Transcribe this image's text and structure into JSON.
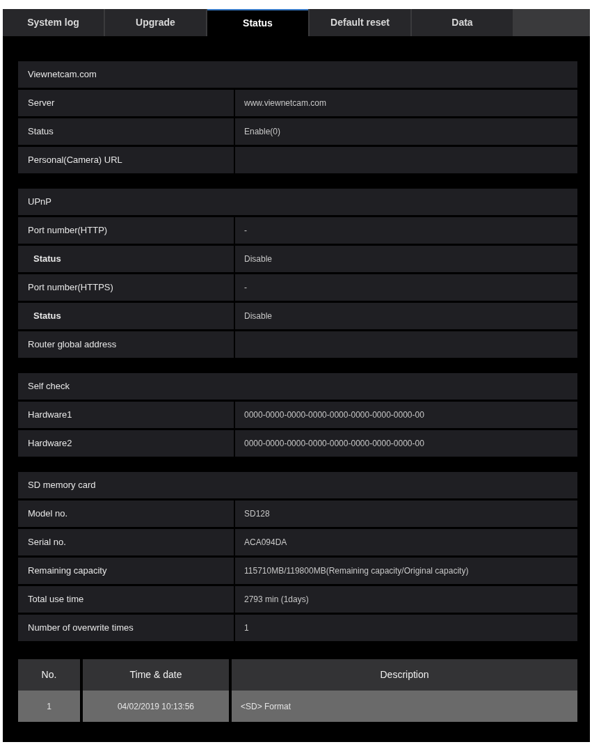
{
  "tabs": [
    {
      "label": "System log",
      "selected": false
    },
    {
      "label": "Upgrade",
      "selected": false
    },
    {
      "label": "Status",
      "selected": true
    },
    {
      "label": "Default reset",
      "selected": false
    },
    {
      "label": "Data",
      "selected": false
    }
  ],
  "sections": [
    {
      "title": "Viewnetcam.com",
      "rows": [
        {
          "label": "Server",
          "value": "www.viewnetcam.com",
          "indented": false
        },
        {
          "label": "Status",
          "value": "Enable(0)",
          "indented": false
        },
        {
          "label": "Personal(Camera) URL",
          "indented": false
        }
      ]
    },
    {
      "title": "UPnP",
      "rows": [
        {
          "label": "Port number(HTTP)",
          "value": "-",
          "indented": false
        },
        {
          "label": "Status",
          "value": "Disable",
          "indented": true
        },
        {
          "label": "Port number(HTTPS)",
          "value": "-",
          "indented": false
        },
        {
          "label": "Status",
          "value": "Disable",
          "indented": true
        },
        {
          "label": "Router global address",
          "indented": false
        }
      ]
    },
    {
      "title": "Self check",
      "rows": [
        {
          "label": "Hardware1",
          "value": "0000-0000-0000-0000-0000-0000-0000-0000-00",
          "indented": false
        },
        {
          "label": "Hardware2",
          "value": "0000-0000-0000-0000-0000-0000-0000-0000-00",
          "indented": false
        }
      ]
    },
    {
      "title": "SD memory card",
      "rows": [
        {
          "label": "Model no.",
          "value": "SD128",
          "indented": false
        },
        {
          "label": "Serial no.",
          "value": "ACA094DA",
          "indented": false
        },
        {
          "label": "Remaining capacity",
          "value": "115710MB/119800MB(Remaining capacity/Original capacity)",
          "indented": false
        },
        {
          "label": "Total use time",
          "value": "2793 min (1days)",
          "indented": false
        },
        {
          "label": "Number of overwrite times",
          "value": "1",
          "indented": false
        }
      ]
    }
  ],
  "log_table": {
    "columns": [
      "No.",
      "Time & date",
      "Description"
    ],
    "rows": [
      [
        "1",
        "04/02/2019 10:13:56",
        "<SD> Format"
      ]
    ]
  }
}
